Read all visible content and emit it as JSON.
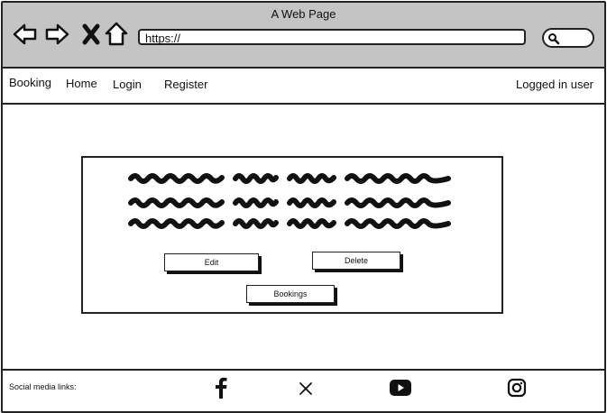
{
  "browser": {
    "title": "A Web Page",
    "url": "https://",
    "icons": [
      "back-arrow-icon",
      "forward-arrow-icon",
      "close-icon",
      "home-icon",
      "search-icon"
    ]
  },
  "nav": {
    "items": [
      "Booking",
      "Home",
      "Login",
      "Register"
    ],
    "user_status": "Logged in user"
  },
  "card": {
    "buttons": {
      "edit": "Edit",
      "delete": "Delete",
      "bookings": "Bookings"
    }
  },
  "footer": {
    "social_label": "Social media links:",
    "icons": [
      "facebook-icon",
      "x-icon",
      "youtube-icon",
      "instagram-icon"
    ]
  }
}
